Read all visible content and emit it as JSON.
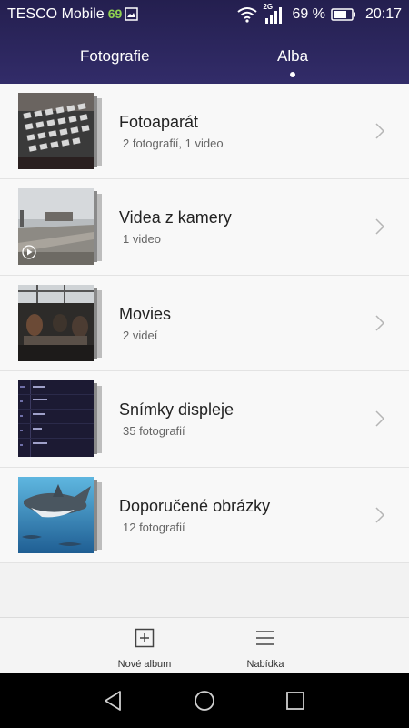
{
  "status": {
    "carrier": "TESCO Mobile",
    "carrier_num": "69",
    "net_type": "2G",
    "battery": "69 %",
    "time": "20:17"
  },
  "tabs": [
    {
      "label": "Fotografie",
      "selected": false
    },
    {
      "label": "Alba",
      "selected": true
    }
  ],
  "albums": [
    {
      "title": "Fotoaparát",
      "subtitle": "2 fotografií,  1 video"
    },
    {
      "title": "Videa z kamery",
      "subtitle": "1 video"
    },
    {
      "title": "Movies",
      "subtitle": "2 videí"
    },
    {
      "title": "Snímky displeje",
      "subtitle": "35 fotografií"
    },
    {
      "title": "Doporučené obrázky",
      "subtitle": "12 fotografií"
    }
  ],
  "toolbar": {
    "new_album_label": "Nové album",
    "menu_label": "Nabídka"
  },
  "colors": {
    "header_bg": "#241f4f",
    "carrier_num": "#8fd14f"
  }
}
